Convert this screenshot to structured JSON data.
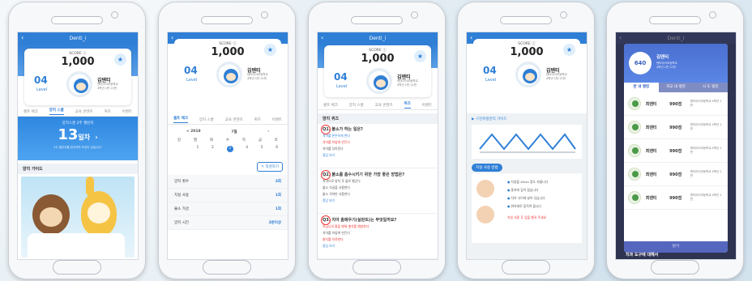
{
  "app": {
    "brand": "Denti_i"
  },
  "profile": {
    "score_label": "SCORE ⓘ",
    "score": "1,000",
    "level": "04",
    "level_label": "Level",
    "name": "김덴티",
    "school": "덴티아이초등학교",
    "grade": "4학년 1반 21번"
  },
  "tabs": [
    "셀프 체크",
    "양치 스쿨",
    "교육 콘텐츠",
    "퀴즈",
    "이벤트"
  ],
  "screen1": {
    "days_label": "양치스쿨 2주 챌린지",
    "days_value": "13",
    "days_unit": "일차",
    "days_sub": "2주 챌린지를 완주하면 보상이 있습니다!",
    "guide_title": "양치 가이드"
  },
  "screen2": {
    "year": "< 2019",
    "month": "7월",
    "weekdays": [
      "일",
      "월",
      "화",
      "수",
      "목",
      "금",
      "토"
    ],
    "dates": [
      "",
      "1",
      "2",
      "3",
      "4",
      "5",
      "6"
    ],
    "write_button": "작성하기",
    "stats": [
      {
        "label": "양치 횟수",
        "value": "3회"
      },
      {
        "label": "치실 사용",
        "value": "1회"
      },
      {
        "label": "불소 가글",
        "value": "1회"
      },
      {
        "label": "양치 시간",
        "value": "3분이상"
      }
    ]
  },
  "screen3": {
    "title": "양치 퀴즈",
    "questions": [
      {
        "q": "Q1. 불소가 하는 일은?",
        "opts": [
          "치아를 튼튼하게 한다",
          "치아를 하얗게 만든다",
          "치아를 닦아준다"
        ],
        "more": "정답 보기"
      },
      {
        "q": "Q2. 불소를 흡수시키기 위한 가장 좋은 방법은?",
        "opts": [
          "치약으로 양치 후 물로 헹군다",
          "불소 가글을 사용한다",
          "불소 치약만 사용한다"
        ],
        "more": "정답 보기"
      },
      {
        "q": "Q3. 치아 홈메우기(실란트)는 무엇일까요?",
        "opts": [
          "어금니의 홈을 메워 충치를 예방한다",
          "치아를 하얗게 만든다",
          "충치를 치료한다"
        ],
        "more": "정답 보기"
      }
    ]
  },
  "screen4": {
    "caption": "▶ 구강위생관리 가이드",
    "sub_title": "치실 사용 방법",
    "steps": [
      "치실을 40cm 정도 자릅니다",
      "중지에 감아 잡습니다",
      "치아 사이에 넣어 닦습니다",
      "위아래로 움직여 줍니다"
    ],
    "note": "치실 사용 후 입을 헹궈 주세요"
  },
  "screen5": {
    "score": "640",
    "tabs": [
      "반 내 랭킹",
      "학교 내 랭킹",
      "시 도 랭킹"
    ],
    "rows": [
      {
        "name": "최덴티",
        "points": "990점",
        "school": "덴티아이초등학교 4학년 1반"
      },
      {
        "name": "최덴티",
        "points": "990점",
        "school": "덴티아이초등학교 4학년 1반"
      },
      {
        "name": "최덴티",
        "points": "990점",
        "school": "덴티아이초등학교 4학년 1반"
      },
      {
        "name": "최덴티",
        "points": "990점",
        "school": "덴티아이초등학교 4학년 1반"
      },
      {
        "name": "최덴티",
        "points": "990점",
        "school": "덴티아이초등학교 4학년 1반"
      }
    ],
    "close": "닫기",
    "bottom_text": "치과 도구에 대해서"
  }
}
